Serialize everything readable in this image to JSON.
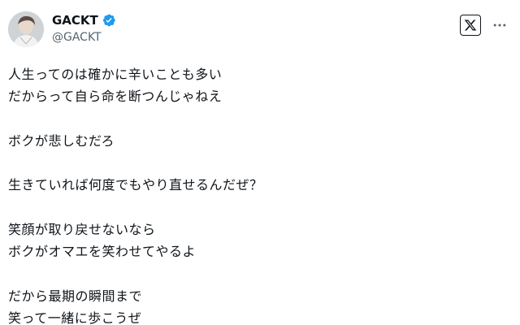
{
  "post": {
    "author": {
      "display_name": "GACKT",
      "handle": "@GACKT",
      "verified": true,
      "verified_color": "#1d9bf0"
    },
    "lines": [
      "人生ってのは確かに辛いことも多い",
      "だからって自ら命を断つんじゃねえ",
      "",
      "ボクが悲しむだろ",
      "",
      "生きていれば何度でもやり直せるんだぜ？",
      "",
      "笑顔が取り戻せないなら",
      "ボクがオマエを笑わせてやるよ",
      "",
      "だから最期の瞬間まで",
      "笑って一緒に歩こうぜ"
    ]
  },
  "icons": {
    "avatar": "profile-photo",
    "verified": "verified-badge-icon",
    "x_logo": "x-logo-icon",
    "more": "more-horizontal-icon"
  },
  "colors": {
    "text": "#0f1419",
    "secondary_text": "#536471",
    "background": "#ffffff"
  }
}
